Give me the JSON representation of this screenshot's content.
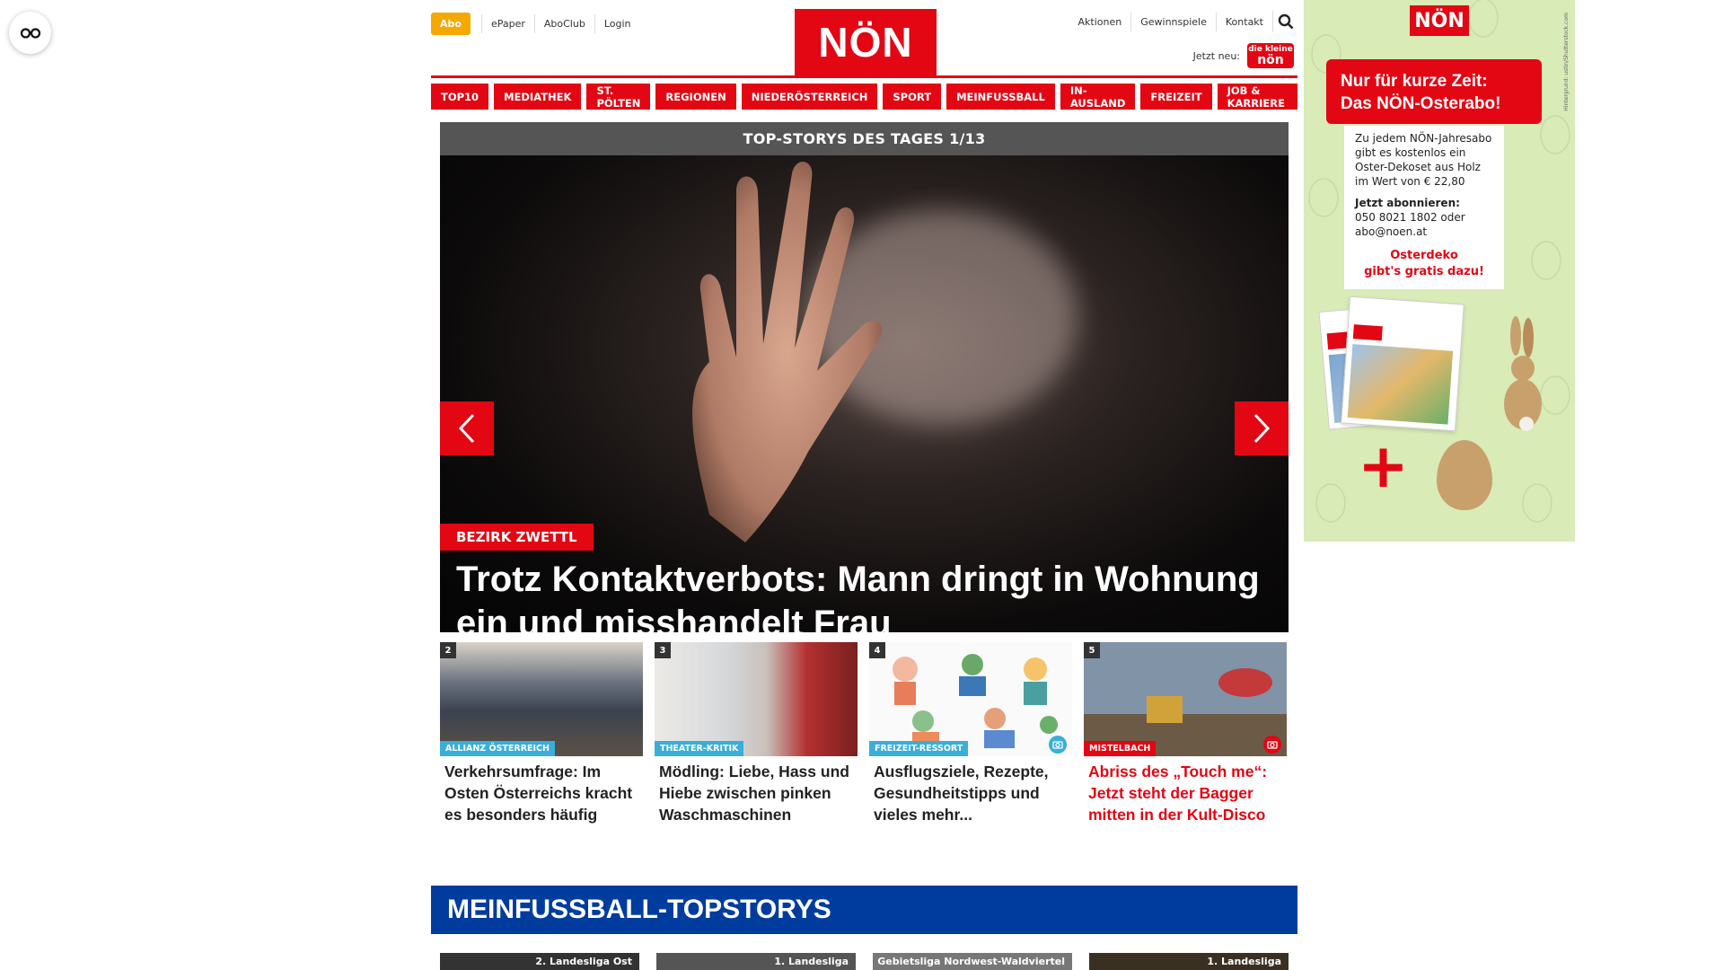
{
  "header": {
    "abo": "Abo",
    "top_links": [
      "ePaper",
      "AboClub",
      "Login"
    ],
    "logo": "NÖN",
    "right_links": [
      "Aktionen",
      "Gewinnspiele",
      "Kontakt"
    ],
    "jetzt_neu": "Jetzt neu:",
    "kleine_small": "die kleine",
    "kleine_big": "nön"
  },
  "nav": [
    "TOP10",
    "MEDIATHEK",
    "ST. PÖLTEN",
    "REGIONEN",
    "NIEDERÖSTERREICH",
    "SPORT",
    "MEINFUSSBALL",
    "IN-AUSLAND",
    "FREIZEIT",
    "JOB & KARRIERE"
  ],
  "hero": {
    "heading": "TOP-STORYS DES TAGES 1/13",
    "tag": "BEZIRK ZWETTL",
    "title": "Trotz Kontaktverbots: Mann dringt in Wohnung ein und misshandelt Frau"
  },
  "subs": [
    {
      "num": "2",
      "tag": "ALLIANZ ÖSTERREICH",
      "tag_color": "#3aaed8",
      "title": "Verkehrsumfrage: Im Osten Österreichs kracht es besonders häufig"
    },
    {
      "num": "3",
      "tag": "THEATER-KRITIK",
      "tag_color": "#3aaed8",
      "title": "Mödling: Liebe, Hass und Hiebe zwischen pinken Waschmaschinen"
    },
    {
      "num": "4",
      "tag": "FREIZEIT-RESSORT",
      "tag_color": "#3aaed8",
      "title": "Ausflugsziele, Rezepte, Gesundheitstipps und vieles mehr..."
    },
    {
      "num": "5",
      "tag": "MISTELBACH",
      "tag_color": "#e30613",
      "title": "Abriss des „Touch me“: Jetzt steht der Bagger mitten in der Kult-Disco"
    }
  ],
  "meinfussball": {
    "heading": "MEINFUSSBALL-TOPSTORYS",
    "labels": [
      "2. Landesliga Ost",
      "1. Landesliga",
      "Gebietsliga Nordwest-Waldviertel",
      "1. Landesliga"
    ]
  },
  "ad": {
    "logo": "NÖN",
    "side": "Hintergrund: ustin/Shutterstock.com",
    "banner_line1": "Nur für kurze Zeit:",
    "banner_line2": "Das NÖN-Osterabo!",
    "card_text": "Zu jedem NÖN-Jahresabo gibt es kostenlos ein Oster-Dekoset aus Holz im Wert von € 22,80",
    "card_bold": "Jetzt abonnieren:",
    "card_contact": "050 8021 1802 oder abo@noen.at",
    "card_red1": "Osterdeko",
    "card_red2": "gibt's gratis dazu!",
    "plus": "+"
  }
}
